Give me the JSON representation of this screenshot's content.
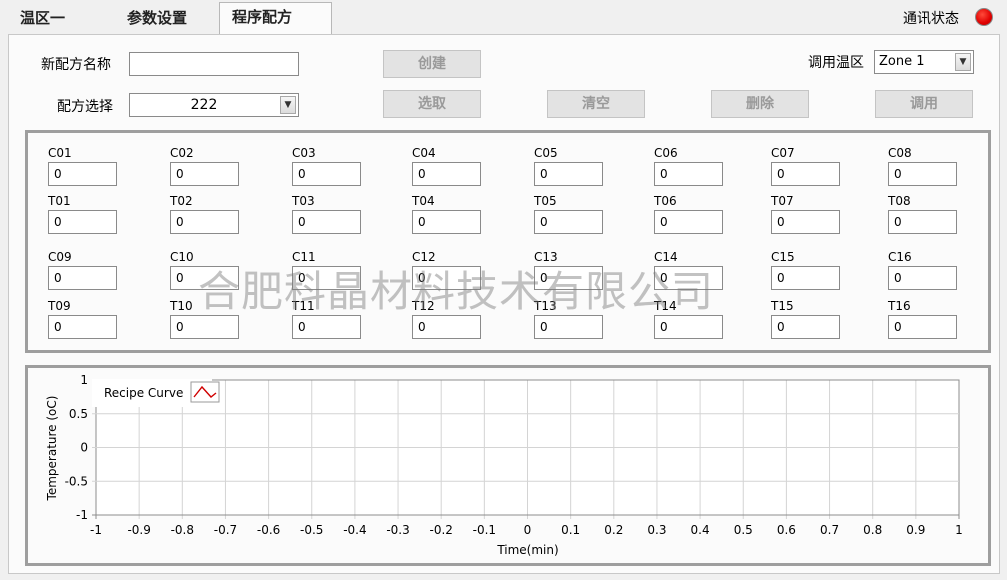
{
  "tabs": [
    {
      "label": "温区一",
      "active": false
    },
    {
      "label": "参数设置",
      "active": false
    },
    {
      "label": "程序配方",
      "active": true
    }
  ],
  "status": {
    "label": "通讯状态",
    "led_color": "#e00000",
    "led_icon": "status-led-icon"
  },
  "recipe": {
    "new_name_label": "新配方名称",
    "new_name_value": "",
    "create_button": "创建",
    "select_label": "配方选择",
    "select_value": "222",
    "load_button": "选取",
    "clear_button": "清空",
    "delete_button": "删除",
    "apply_button": "调用",
    "zone_label": "调用温区",
    "zone_value": "Zone 1"
  },
  "params": [
    {
      "label": "C01",
      "value": "0"
    },
    {
      "label": "C02",
      "value": "0"
    },
    {
      "label": "C03",
      "value": "0"
    },
    {
      "label": "C04",
      "value": "0"
    },
    {
      "label": "C05",
      "value": "0"
    },
    {
      "label": "C06",
      "value": "0"
    },
    {
      "label": "C07",
      "value": "0"
    },
    {
      "label": "C08",
      "value": "0"
    },
    {
      "label": "T01",
      "value": "0"
    },
    {
      "label": "T02",
      "value": "0"
    },
    {
      "label": "T03",
      "value": "0"
    },
    {
      "label": "T04",
      "value": "0"
    },
    {
      "label": "T05",
      "value": "0"
    },
    {
      "label": "T06",
      "value": "0"
    },
    {
      "label": "T07",
      "value": "0"
    },
    {
      "label": "T08",
      "value": "0"
    },
    {
      "label": "C09",
      "value": "0"
    },
    {
      "label": "C10",
      "value": "0"
    },
    {
      "label": "C11",
      "value": "0"
    },
    {
      "label": "C12",
      "value": "0"
    },
    {
      "label": "C13",
      "value": "0"
    },
    {
      "label": "C14",
      "value": "0"
    },
    {
      "label": "C15",
      "value": "0"
    },
    {
      "label": "C16",
      "value": "0"
    },
    {
      "label": "T09",
      "value": "0"
    },
    {
      "label": "T10",
      "value": "0"
    },
    {
      "label": "T11",
      "value": "0"
    },
    {
      "label": "T12",
      "value": "0"
    },
    {
      "label": "T13",
      "value": "0"
    },
    {
      "label": "T14",
      "value": "0"
    },
    {
      "label": "T15",
      "value": "0"
    },
    {
      "label": "T16",
      "value": "0"
    }
  ],
  "watermark": "合肥科晶材料技术有限公司",
  "chart_data": {
    "type": "line",
    "legend": "Recipe Curve",
    "legend_placement": "top-left",
    "xlabel": "Time(min)",
    "ylabel": "Temperature (oC)",
    "xlim": [
      -1,
      1
    ],
    "ylim": [
      -1,
      1
    ],
    "x_ticks": [
      "-1",
      "-0.9",
      "-0.8",
      "-0.7",
      "-0.6",
      "-0.5",
      "-0.4",
      "-0.3",
      "-0.2",
      "-0.1",
      "0",
      "0.1",
      "0.2",
      "0.3",
      "0.4",
      "0.5",
      "0.6",
      "0.7",
      "0.8",
      "0.9",
      "1"
    ],
    "y_ticks": [
      "1",
      "0.5",
      "0",
      "-0.5",
      "-1"
    ],
    "grid": true,
    "series": [
      {
        "name": "Recipe Curve",
        "color": "#d00000",
        "x": [],
        "y": []
      }
    ]
  }
}
